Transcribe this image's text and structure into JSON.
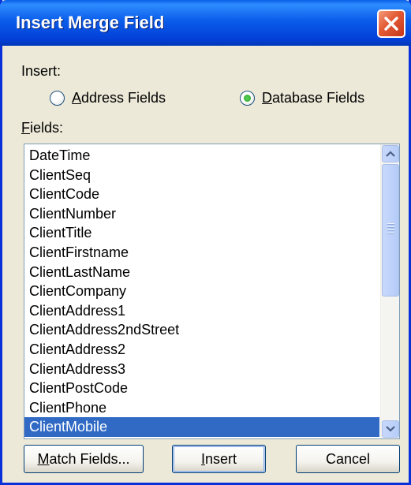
{
  "dialog": {
    "title": "Insert Merge Field"
  },
  "insert_group": {
    "label": "Insert:",
    "options": [
      {
        "label": "Address Fields",
        "selected": false
      },
      {
        "label": "Database Fields",
        "selected": true
      }
    ]
  },
  "fields": {
    "label": "Fields:",
    "items": [
      "DateTime",
      "ClientSeq",
      "ClientCode",
      "ClientNumber",
      "ClientTitle",
      "ClientFirstname",
      "ClientLastName",
      "ClientCompany",
      "ClientAddress1",
      "ClientAddress2ndStreet",
      "ClientAddress2",
      "ClientAddress3",
      "ClientPostCode",
      "ClientPhone",
      "ClientMobile"
    ],
    "selected": "ClientMobile"
  },
  "buttons": {
    "match_fields": "Match Fields...",
    "insert": "Insert",
    "cancel": "Cancel"
  },
  "colors": {
    "title_bar": "#0a5dea",
    "selection": "#316ac5",
    "close": "#e25a34",
    "face": "#ece9d8"
  },
  "icons": {
    "close": "close-icon",
    "scroll_up": "chevron-up-icon",
    "scroll_down": "chevron-down-icon"
  }
}
